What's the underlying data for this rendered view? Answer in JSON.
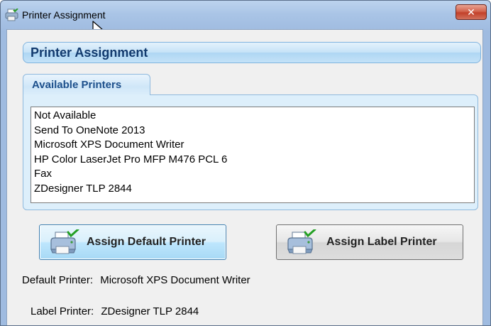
{
  "window": {
    "title": "Printer Assignment",
    "close_label": "✕"
  },
  "header": {
    "title": "Printer Assignment"
  },
  "tab": {
    "label": "Available Printers"
  },
  "printers": {
    "items": [
      "Not Available",
      "Send To OneNote 2013",
      "Microsoft XPS Document Writer",
      "HP Color LaserJet Pro MFP M476 PCL 6",
      "Fax",
      "ZDesigner TLP 2844"
    ]
  },
  "buttons": {
    "assign_default": "Assign Default Printer",
    "assign_label": "Assign Label Printer"
  },
  "info": {
    "default_key": "Default Printer:",
    "default_value": "Microsoft XPS Document Writer",
    "label_key": "Label Printer:",
    "label_value": "ZDesigner TLP 2844"
  },
  "colors": {
    "header_text": "#123a6e",
    "tab_text": "#1c4f8b",
    "group_bg": "#ddeffb",
    "close_red": "#c2402a"
  }
}
